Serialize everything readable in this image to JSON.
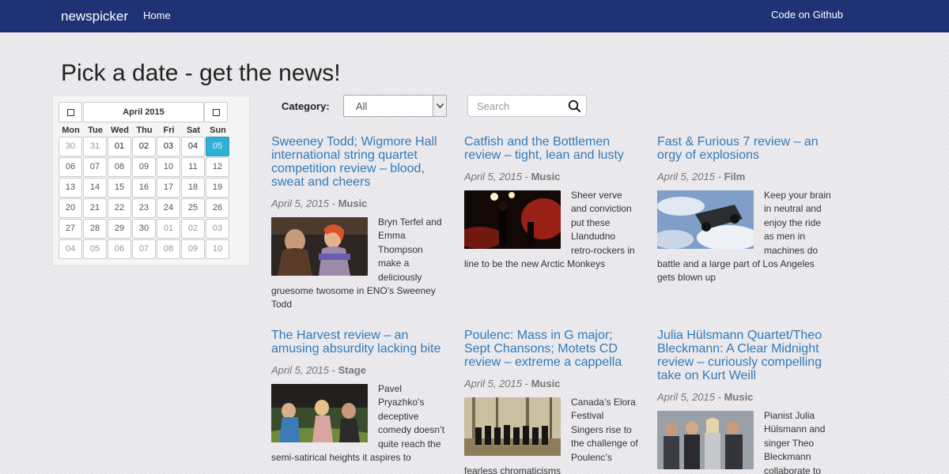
{
  "navbar": {
    "brand": "newspicker",
    "home": "Home",
    "github": "Code on Github"
  },
  "page_title": "Pick a date - get the news!",
  "calendar": {
    "month": "April 2015",
    "weekdays": [
      "Mon",
      "Tue",
      "Wed",
      "Thu",
      "Fri",
      "Sat",
      "Sun"
    ],
    "days": [
      {
        "label": "30",
        "state": "muted"
      },
      {
        "label": "31",
        "state": "muted"
      },
      {
        "label": "01",
        "state": "strong"
      },
      {
        "label": "02",
        "state": "strong"
      },
      {
        "label": "03",
        "state": "strong"
      },
      {
        "label": "04",
        "state": "strong"
      },
      {
        "label": "05",
        "state": "selected"
      },
      {
        "label": "06",
        "state": "past"
      },
      {
        "label": "07",
        "state": "past"
      },
      {
        "label": "08",
        "state": "past"
      },
      {
        "label": "09",
        "state": "past"
      },
      {
        "label": "10",
        "state": "past"
      },
      {
        "label": "11",
        "state": "past"
      },
      {
        "label": "12",
        "state": "past"
      },
      {
        "label": "13",
        "state": "past"
      },
      {
        "label": "14",
        "state": "past"
      },
      {
        "label": "15",
        "state": "past"
      },
      {
        "label": "16",
        "state": "past"
      },
      {
        "label": "17",
        "state": "past"
      },
      {
        "label": "18",
        "state": "past"
      },
      {
        "label": "19",
        "state": "past"
      },
      {
        "label": "20",
        "state": "past"
      },
      {
        "label": "21",
        "state": "past"
      },
      {
        "label": "22",
        "state": "past"
      },
      {
        "label": "23",
        "state": "past"
      },
      {
        "label": "24",
        "state": "past"
      },
      {
        "label": "25",
        "state": "past"
      },
      {
        "label": "26",
        "state": "past"
      },
      {
        "label": "27",
        "state": "past"
      },
      {
        "label": "28",
        "state": "past"
      },
      {
        "label": "29",
        "state": "past"
      },
      {
        "label": "30",
        "state": "past"
      },
      {
        "label": "01",
        "state": "muted"
      },
      {
        "label": "02",
        "state": "muted"
      },
      {
        "label": "03",
        "state": "muted"
      },
      {
        "label": "04",
        "state": "muted"
      },
      {
        "label": "05",
        "state": "muted"
      },
      {
        "label": "06",
        "state": "muted"
      },
      {
        "label": "07",
        "state": "muted"
      },
      {
        "label": "08",
        "state": "muted"
      },
      {
        "label": "09",
        "state": "muted"
      },
      {
        "label": "10",
        "state": "muted"
      }
    ],
    "selected_color": "#31b0d5"
  },
  "filters": {
    "category_label": "Category:",
    "category_value": "All",
    "search_placeholder": "Search"
  },
  "articles": [
    {
      "title": "Sweeney Todd; Wigmore Hall international string quartet competition review – blood, sweat and cheers",
      "date": "April 5, 2015",
      "sep": " - ",
      "category": "Music",
      "summary": "Bryn Terfel and Emma Thompson make a deliciously gruesome twosome in ENO’s Sweeney Todd"
    },
    {
      "title": "Catfish and the Bottlemen review – tight, lean and lusty",
      "date": "April 5, 2015",
      "sep": " - ",
      "category": "Music",
      "summary": "Sheer verve and conviction put these Llandudno retro-rockers in line to be the new Arctic Monkeys"
    },
    {
      "title": "Fast & Furious 7 review – an orgy of explosions",
      "date": "April 5, 2015",
      "sep": " - ",
      "category": "Film",
      "summary": "Keep your brain in neutral and enjoy the ride as men in machines do battle and a large part of Los Angeles gets blown up"
    },
    {
      "title": "The Harvest review – an amusing absurdity lacking bite",
      "date": "April 5, 2015",
      "sep": " - ",
      "category": "Stage",
      "summary": "Pavel Pryazhko’s deceptive comedy doesn’t quite reach the semi-satirical heights it aspires to"
    },
    {
      "title": "Poulenc: Mass in G major; Sept Chansons; Motets CD review – extreme a cappella",
      "date": "April 5, 2015",
      "sep": " - ",
      "category": "Music",
      "summary": "Canada’s Elora Festival Singers rise to the challenge of Poulenc’s fearless chromaticisms"
    },
    {
      "title": "Julia Hülsmann Quartet/Theo Bleckmann: A Clear Midnight review – curiously compelling take on Kurt Weill",
      "date": "April 5, 2015",
      "sep": " - ",
      "category": "Music",
      "summary": "Pianist Julia Hülsmann and singer Theo Bleckmann collaborate to"
    }
  ],
  "colors": {
    "navbar": "#1f3275",
    "link": "#337ab7",
    "meta": "#777777"
  }
}
